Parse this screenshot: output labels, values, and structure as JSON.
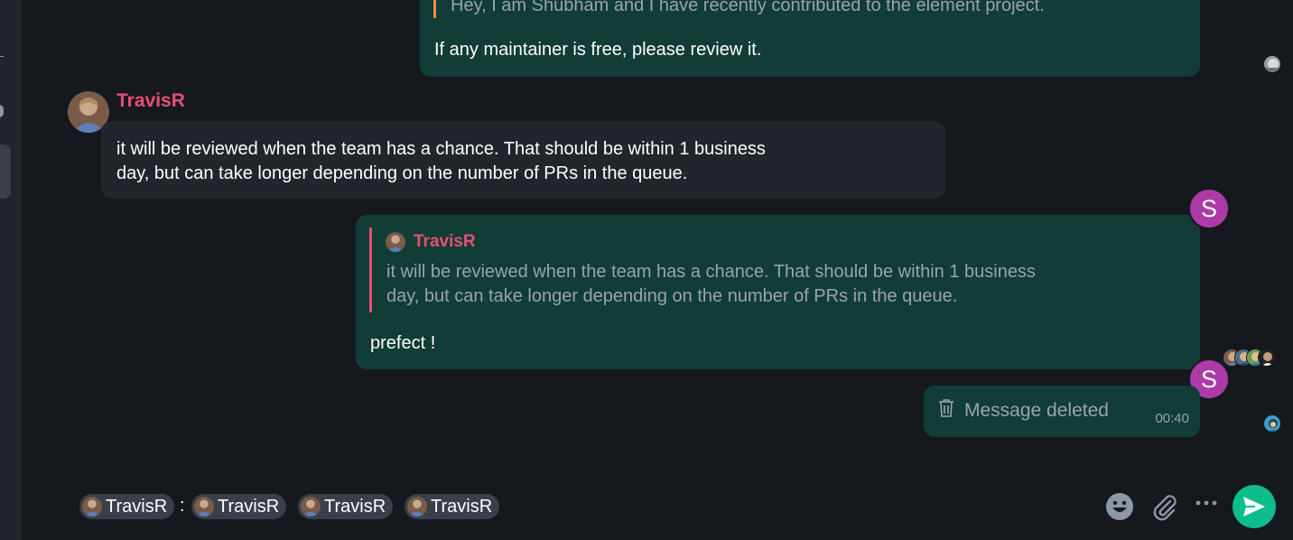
{
  "messages": {
    "m1": {
      "quote_text": "Hey, I am Shubham and I have recently contributed to the element project.",
      "body": "If any maintainer is free, please review it."
    },
    "m2": {
      "sender": "TravisR",
      "body_line1": "it will be reviewed when the team has a chance. That should be within 1 business",
      "body_line2": "day, but can take longer depending on the number of PRs in the queue."
    },
    "m3": {
      "avatar_letter": "S",
      "quote_sender": "TravisR",
      "quote_line1": "it will be reviewed when the team has a chance. That should be within 1 business",
      "quote_line2": "day, but can take longer depending on the number of PRs in the queue.",
      "body": "prefect !"
    },
    "m4": {
      "avatar_letter": "S",
      "deleted_label": "Message deleted",
      "timestamp": "00:40"
    }
  },
  "composer": {
    "pills": [
      "TravisR",
      "TravisR",
      "TravisR",
      "TravisR"
    ],
    "separator": ":"
  },
  "colors": {
    "accent": "#0dbd8b",
    "own_bubble": "#123c36",
    "other_bubble": "#21262c",
    "username_pink": "#e64f7a",
    "avatar_purple": "#ac3ba8",
    "quote_orange": "#ee8d3f"
  },
  "icons": [
    "trash-icon",
    "emoji-icon",
    "attachment-icon",
    "more-options-icon",
    "send-icon"
  ]
}
